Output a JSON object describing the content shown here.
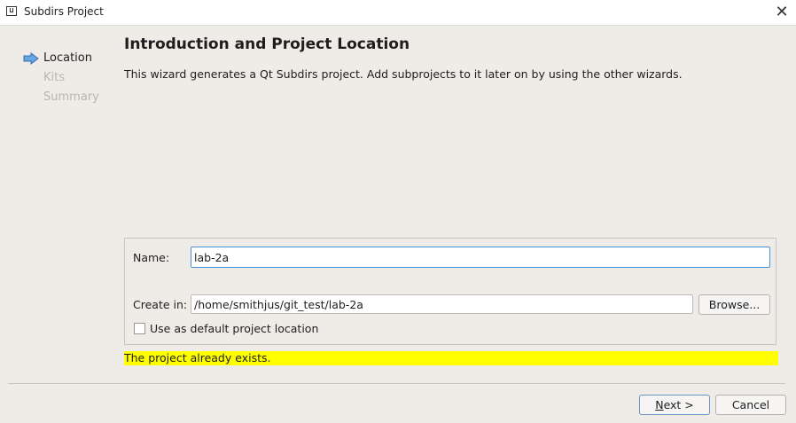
{
  "window": {
    "title": "Subdirs Project",
    "close_icon": "close-icon"
  },
  "steps": [
    {
      "label": "Location",
      "state": "current"
    },
    {
      "label": "Kits",
      "state": "pending"
    },
    {
      "label": "Summary",
      "state": "pending"
    }
  ],
  "page": {
    "heading": "Introduction and Project Location",
    "intro": "This wizard generates a Qt Subdirs project. Add subprojects to it later on by using the other wizards."
  },
  "form": {
    "name_label": "Name:",
    "name_value": "lab-2a",
    "create_in_label": "Create in:",
    "create_in_value": "/home/smithjus/git_test/lab-2a",
    "browse_label": "Browse...",
    "default_location_label": "Use as default project location",
    "default_location_checked": false
  },
  "warning": {
    "text": "The project already exists.",
    "color": "#ffff00"
  },
  "buttons": {
    "next_label": "Next >",
    "cancel_label": "Cancel"
  },
  "colors": {
    "background": "#efebe7",
    "focus": "#4a90d9",
    "step_arrow": "#4a90d9"
  }
}
